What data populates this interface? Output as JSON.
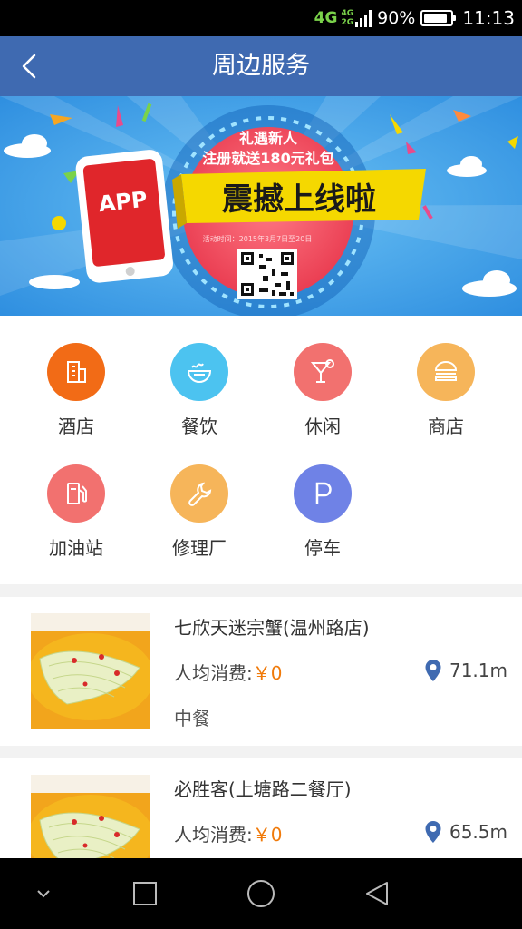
{
  "status_bar": {
    "network_primary": "4G",
    "network_secondary_top": "4G",
    "network_secondary_bottom": "2G",
    "battery_percent": "90%",
    "battery_level": 0.9,
    "time": "11:13"
  },
  "header": {
    "title": "周边服务",
    "back_icon": "chevron-left-icon"
  },
  "banner": {
    "app_label": "APP",
    "line1": "礼遇新人",
    "line2": "注册就送180元礼包",
    "headline": "震撼上线啦",
    "activity_time": "活动时间：2015年3月7日至20日",
    "colors": {
      "sky": "#3a9be6",
      "ribbon": "#f5d800",
      "disc": "#f04d5e",
      "phone": "#e0262b"
    }
  },
  "categories": [
    {
      "label": "酒店",
      "icon": "building-icon",
      "color": "#f26b16"
    },
    {
      "label": "餐饮",
      "icon": "bowl-icon",
      "color": "#4cc3f0"
    },
    {
      "label": "休闲",
      "icon": "cocktail-icon",
      "color": "#f2716f"
    },
    {
      "label": "商店",
      "icon": "burger-icon",
      "color": "#f6b55a"
    },
    {
      "label": "加油站",
      "icon": "fuel-pump-icon",
      "color": "#f2716f"
    },
    {
      "label": "修理厂",
      "icon": "wrench-icon",
      "color": "#f6b55a"
    },
    {
      "label": "停车",
      "icon": "parking-icon",
      "color": "#6f82e6"
    }
  ],
  "list": [
    {
      "name": "七欣天迷宗蟹(温州路店)",
      "price_label": "人均消费:",
      "price_value": "￥0",
      "distance": "71.1m",
      "category": "中餐"
    },
    {
      "name": "必胜客(上塘路二餐厅)",
      "price_label": "人均消费:",
      "price_value": "￥0",
      "distance": "65.5m",
      "category": ""
    }
  ],
  "colors": {
    "header_bg": "#3f6ab1",
    "price": "#f07a0a",
    "location_pin": "#3f6ab1"
  }
}
